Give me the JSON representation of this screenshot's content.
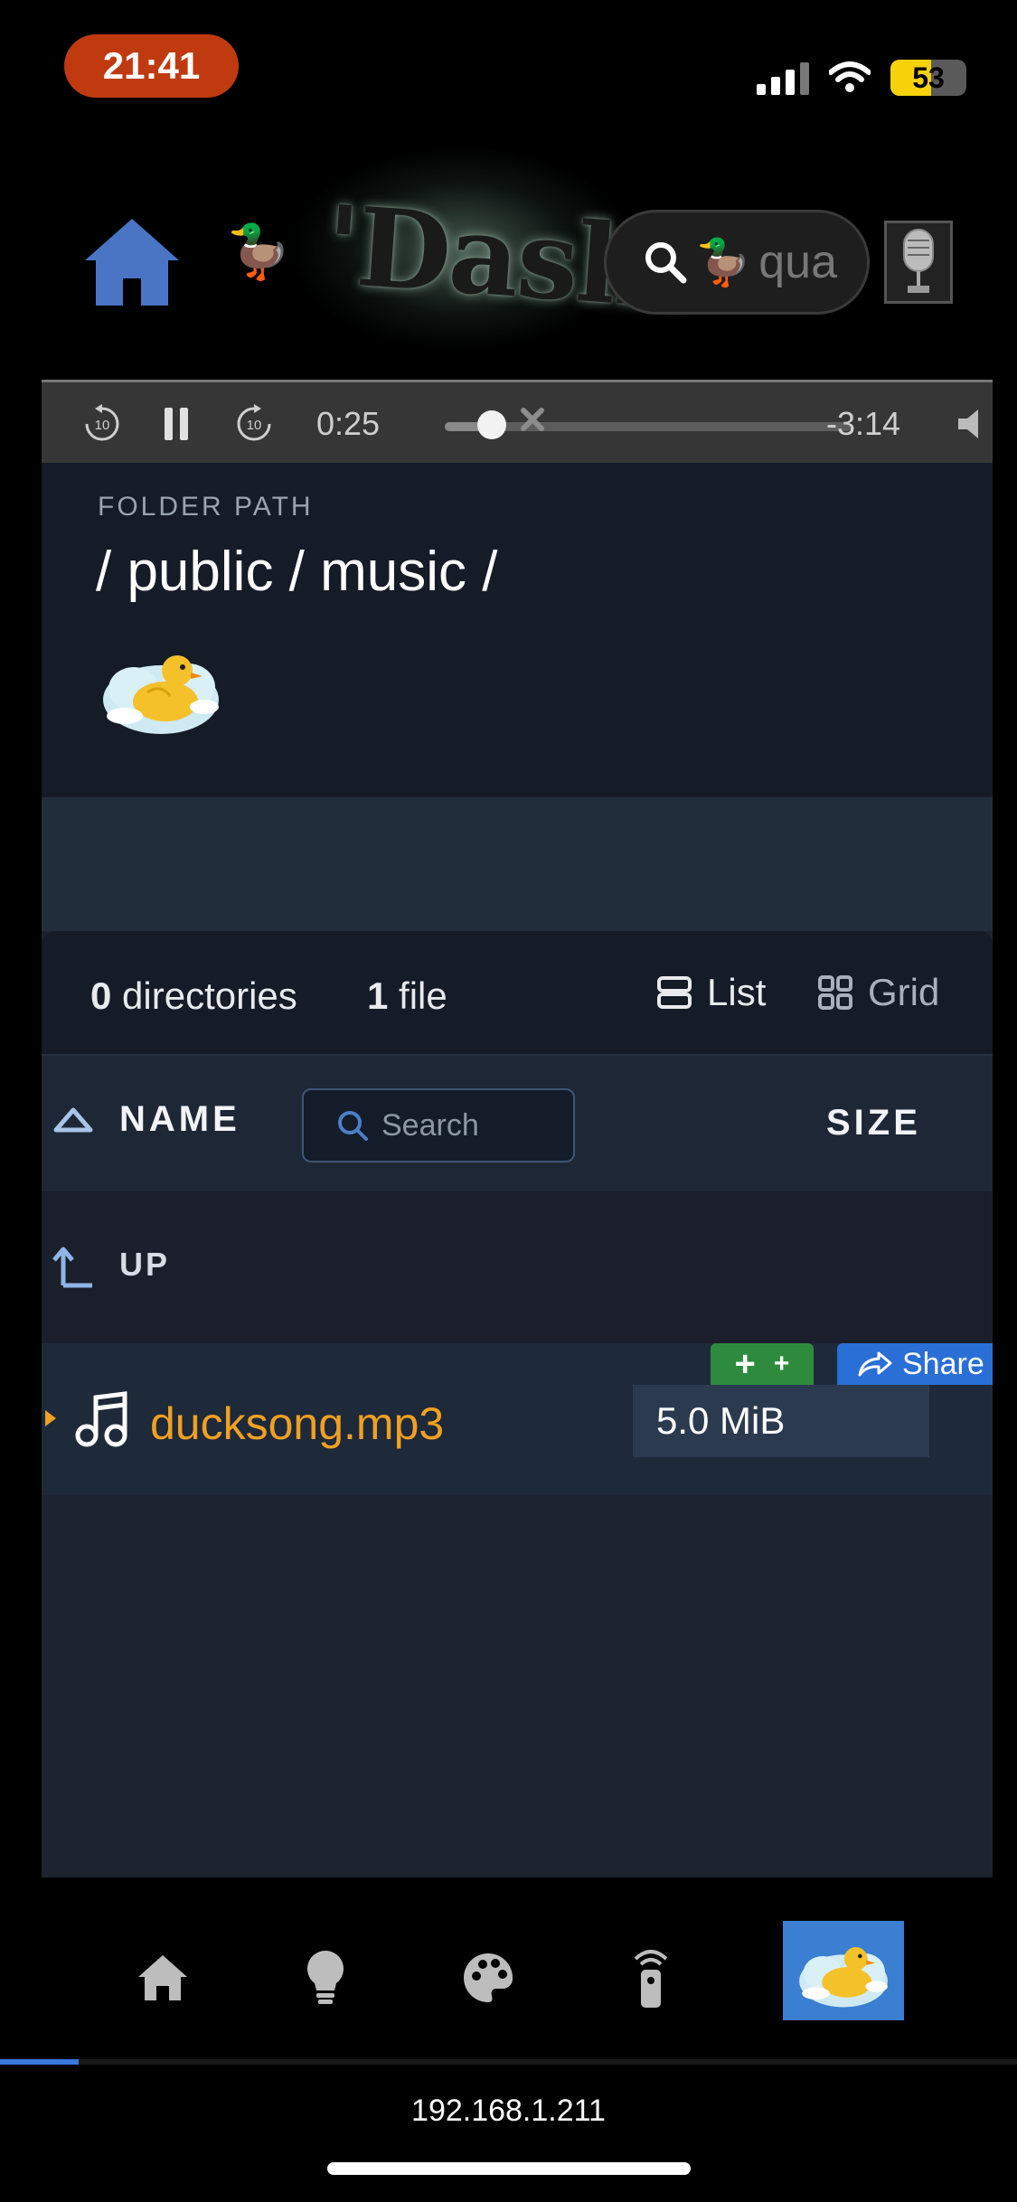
{
  "status_bar": {
    "time": "21:41",
    "battery": "53",
    "battery_level": 0.53
  },
  "header": {
    "logo_text": "'Dash!",
    "search_placeholder": "qua"
  },
  "player": {
    "elapsed": "0:25",
    "remaining": "-3:14",
    "progress": 0.115,
    "skip_back_label": "10",
    "skip_forward_label": "10"
  },
  "folder": {
    "label": "FOLDER PATH",
    "path": "/ public / music /"
  },
  "listing": {
    "dir_count": "0",
    "dir_label": "directories",
    "file_count": "1",
    "file_label": "file",
    "view_list": "List",
    "view_grid": "Grid",
    "col_name": "NAME",
    "col_size": "SIZE",
    "search_placeholder": "Search",
    "up_label": "UP",
    "files": [
      {
        "name": "ducksong.mp3",
        "size": "5.0 MiB"
      }
    ],
    "add_label": "+",
    "share_label": "Share"
  },
  "footer": {
    "url": "192.168.1.211",
    "load_progress": 0.077
  },
  "colors": {
    "accent": "#3a7fd2",
    "file_name": "#f0a020",
    "add_green": "#2e8b3e",
    "share_blue": "#2a6fd6"
  },
  "icons": [
    "home-icon",
    "duck-icon",
    "search-icon",
    "microphone-icon",
    "replay-10-icon",
    "pause-icon",
    "forward-10-icon",
    "close-icon",
    "volume-icon",
    "list-icon",
    "grid-icon",
    "sort-asc-icon",
    "up-arrow-icon",
    "music-note-icon",
    "share-icon",
    "lightbulb-icon",
    "palette-icon",
    "remote-icon"
  ]
}
